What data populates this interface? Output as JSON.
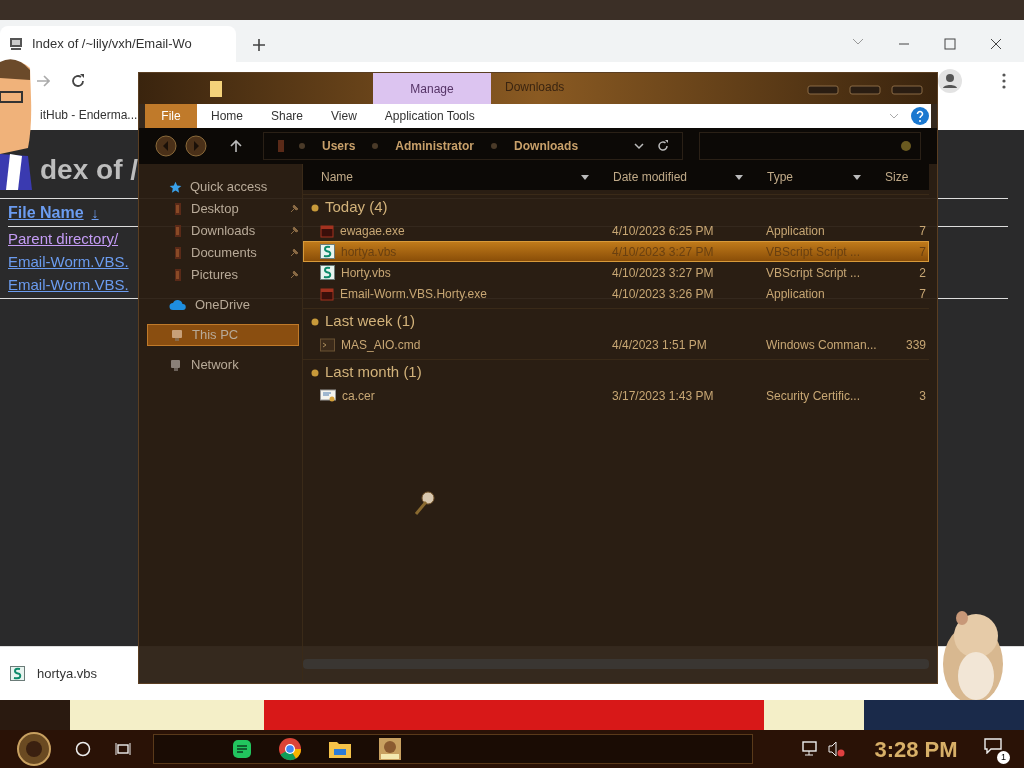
{
  "browser": {
    "tab_title": "Index of /~lily/vxh/Email-Wo",
    "bookmark": "itHub - Enderma...",
    "page": {
      "heading": "dex of /",
      "table": {
        "column": "File Name",
        "sort_mark": "↓",
        "rows": [
          "Parent directory/",
          "Email-Worm.VBS.",
          "Email-Worm.VBS."
        ]
      }
    },
    "download_shelf": {
      "file": "hortya.vbs"
    }
  },
  "explorer": {
    "contextual_tab": "Manage",
    "title": "Downloads",
    "file_button": "File",
    "ribbon_tabs": [
      "Home",
      "Share",
      "View",
      "Application Tools"
    ],
    "breadcrumb": [
      "Users",
      "Administrator",
      "Downloads"
    ],
    "nav": [
      {
        "label": "Quick access",
        "kind": "star",
        "selected": false,
        "pinned": false
      },
      {
        "label": "Desktop",
        "kind": "folder",
        "selected": false,
        "pinned": true
      },
      {
        "label": "Downloads",
        "kind": "folder",
        "selected": false,
        "pinned": true
      },
      {
        "label": "Documents",
        "kind": "folder",
        "selected": false,
        "pinned": true
      },
      {
        "label": "Pictures",
        "kind": "folder",
        "selected": false,
        "pinned": true
      },
      {
        "label": "OneDrive",
        "kind": "cloud",
        "selected": false,
        "pinned": false
      },
      {
        "label": "This PC",
        "kind": "pc",
        "selected": true,
        "pinned": false
      },
      {
        "label": "Network",
        "kind": "network",
        "selected": false,
        "pinned": false
      }
    ],
    "columns": [
      "Name",
      "Date modified",
      "Type",
      "Size"
    ],
    "groups": [
      {
        "label": "Today (4)",
        "files": [
          {
            "name": "ewagae.exe",
            "date": "4/10/2023 6:25 PM",
            "type": "Application",
            "size": "7",
            "kind": "exe",
            "selected": false
          },
          {
            "name": "hortya.vbs",
            "date": "4/10/2023 3:27 PM",
            "type": "VBScript Script ...",
            "size": "7",
            "kind": "vbs",
            "selected": true
          },
          {
            "name": "Horty.vbs",
            "date": "4/10/2023 3:27 PM",
            "type": "VBScript Script ...",
            "size": "2",
            "kind": "vbs",
            "selected": false
          },
          {
            "name": "Email-Worm.VBS.Horty.exe",
            "date": "4/10/2023 3:26 PM",
            "type": "Application",
            "size": "7",
            "kind": "exe",
            "selected": false
          }
        ]
      },
      {
        "label": "Last week (1)",
        "files": [
          {
            "name": "MAS_AIO.cmd",
            "date": "4/4/2023 1:51 PM",
            "type": "Windows Comman...",
            "size": "339",
            "kind": "cmd",
            "selected": false
          }
        ]
      },
      {
        "label": "Last month (1)",
        "files": [
          {
            "name": "ca.cer",
            "date": "3/17/2023 1:43 PM",
            "type": "Security Certific...",
            "size": "3",
            "kind": "cer",
            "selected": false
          }
        ]
      }
    ]
  },
  "taskbar": {
    "clock": "3:28 PM",
    "notification_count": "1"
  }
}
